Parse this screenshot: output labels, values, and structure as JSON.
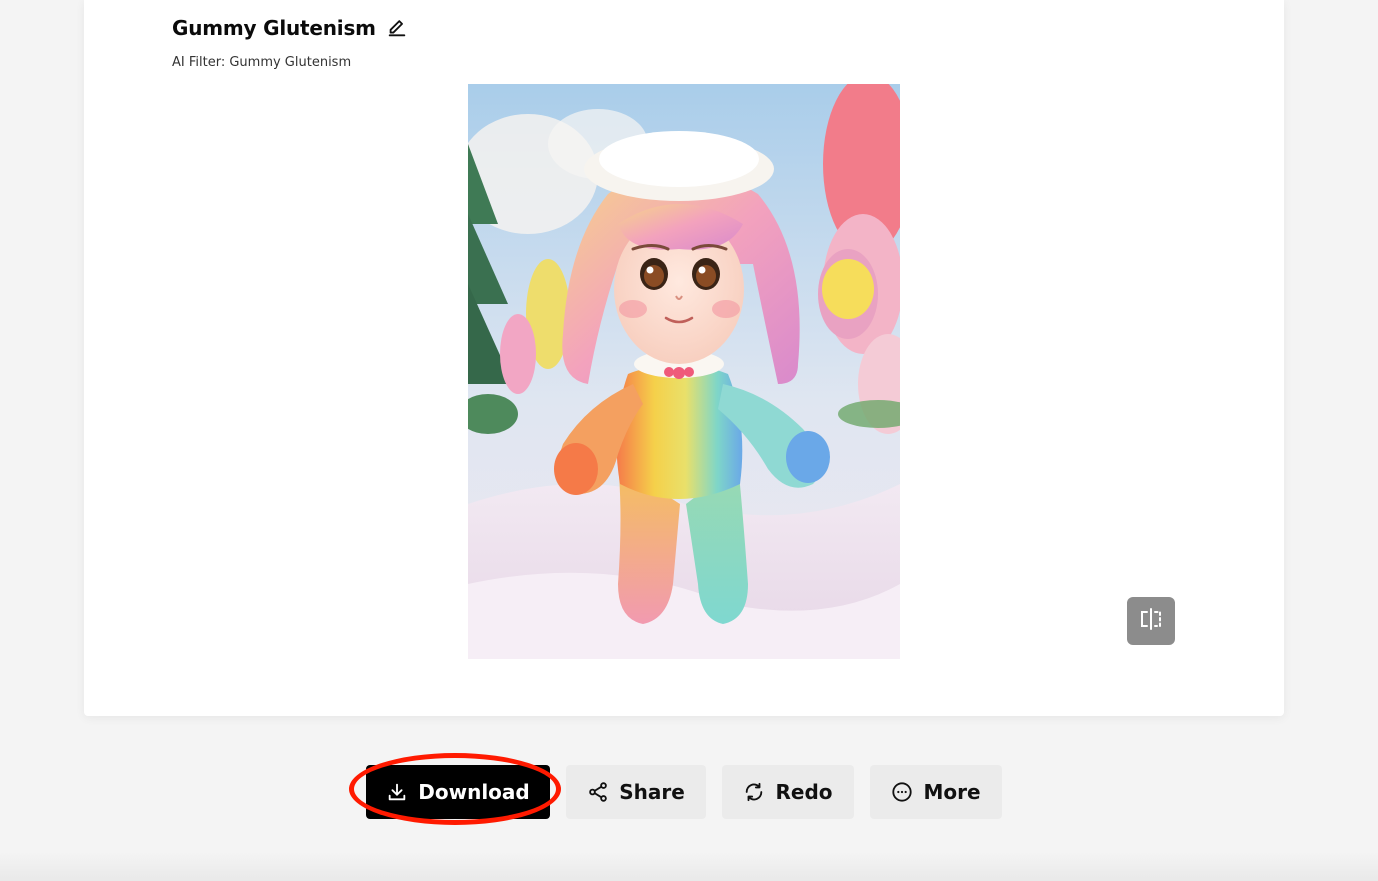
{
  "header": {
    "title": "Gummy Glutenism",
    "subtitle": "AI Filter: Gummy Glutenism"
  },
  "image": {
    "alt": "Gummy Glutenism"
  },
  "actions": {
    "download_label": "Download",
    "share_label": "Share",
    "redo_label": "Redo",
    "more_label": "More"
  },
  "icons": {
    "edit": "pencil-edit-icon",
    "compare": "compare-split-icon",
    "download": "download-icon",
    "share": "share-icon",
    "redo": "redo-icon",
    "more": "more-dots-icon"
  },
  "colors": {
    "primary_button": "#000000",
    "secondary_button": "#ebebeb",
    "highlight_ring": "#ff1a00",
    "compare_button": "#8c8c8c",
    "page_background": "#f4f4f4"
  }
}
